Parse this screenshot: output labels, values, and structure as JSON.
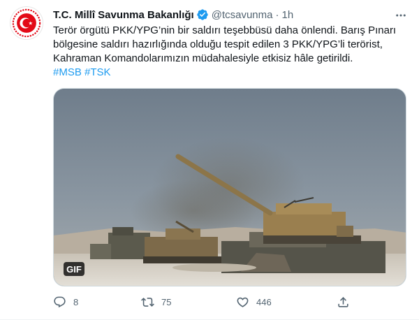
{
  "tweet": {
    "author": {
      "name": "T.C. Millî Savunma Bakanlığı",
      "handle": "@tcsavunma",
      "separator": "·",
      "time": "1h",
      "avatar_icon": "msb-emblem-avatar",
      "verified_icon": "verified-badge-icon"
    },
    "text_lines": [
      "Terör örgütü PKK/YPG’nin bir saldırı teşebbüsü daha önlendi. Barış Pınarı",
      "bölgesine saldırı hazırlığında olduğu tespit edilen 3 PKK/YPG’li terörist,",
      "Kahraman Komandolarımızın müdahalesiyle etkisiz hâle getirildi."
    ],
    "hashtags": "#MSB #TSK",
    "media": {
      "type_badge": "GIF",
      "icon": "howitzer-scene-image"
    },
    "actions": {
      "reply_count": "8",
      "retweet_count": "75",
      "like_count": "446"
    },
    "colors": {
      "accent": "#1d9bf0",
      "secondary_text": "#536471",
      "primary_text": "#0f1419",
      "emblem_red": "#e30a17"
    }
  }
}
